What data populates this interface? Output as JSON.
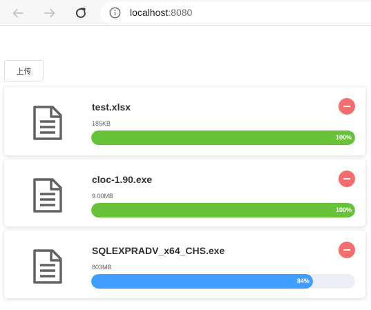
{
  "browser": {
    "url_host": "localhost",
    "url_port": ":8080",
    "icons": [
      "back-arrow-icon",
      "forward-arrow-icon",
      "reload-icon",
      "info-icon"
    ]
  },
  "upload_button": {
    "label": "上传"
  },
  "files": [
    {
      "name": "test.xlsx",
      "size": "185KB",
      "progress": 100,
      "progress_label": "100%",
      "status_color": "#67c23a"
    },
    {
      "name": "cloc-1.90.exe",
      "size": "9.00MB",
      "progress": 100,
      "progress_label": "100%",
      "status_color": "#67c23a"
    },
    {
      "name": "SQLEXPRADV_x64_CHS.exe",
      "size": "803MB",
      "progress": 84,
      "progress_label": "84%",
      "status_color": "#409eff"
    }
  ],
  "colors": {
    "remove": "#f56c6c",
    "track": "#ebeef5",
    "icon": "#606266"
  }
}
